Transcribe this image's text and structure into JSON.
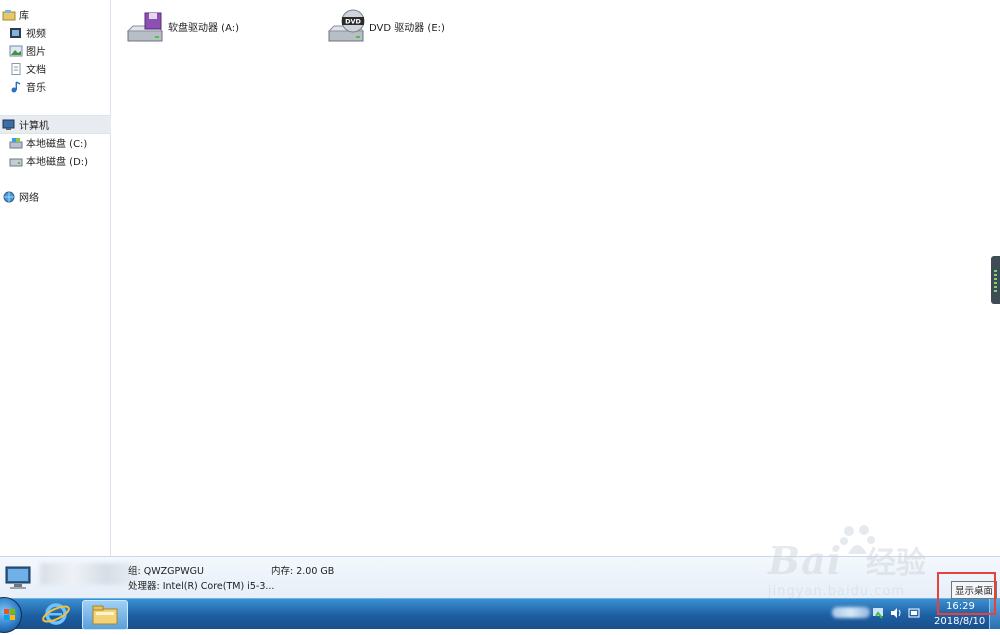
{
  "nav": {
    "libraries": "库",
    "videos": "视频",
    "pictures": "图片",
    "documents": "文档",
    "music": "音乐",
    "computer": "计算机",
    "disk_c": "本地磁盘 (C:)",
    "disk_d": "本地磁盘 (D:)",
    "network": "网络"
  },
  "drives": [
    {
      "label": "软盘驱动器 (A:)",
      "icon": "floppy-drive-icon"
    },
    {
      "label": "DVD 驱动器 (E:)",
      "icon": "dvd-drive-icon"
    }
  ],
  "dvd_icon_text": "DVD",
  "details": {
    "workgroup": "组: QWZGPWGU",
    "memory": "内存: 2.00 GB",
    "processor": "处理器: Intel(R) Core(TM) i5-3..."
  },
  "taskbar": {
    "time": "16:29",
    "date": "2018/8/10",
    "tooltip": "显示桌面"
  },
  "watermark": {
    "brand": "Bai",
    "brand2": "经验",
    "url": "jingyan.baidu.com"
  },
  "colors": {
    "taskbar": "#1d5fa3",
    "highlight": "#e8413a",
    "nav_selected": "#e8ecf1"
  }
}
